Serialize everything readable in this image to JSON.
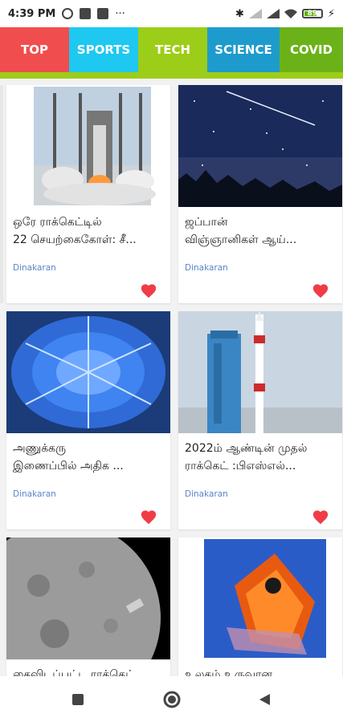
{
  "status_bar": {
    "time": "4:39 PM",
    "more": "···",
    "battery": "89"
  },
  "tabs": [
    {
      "label": "TOP",
      "color": "#f04e4e"
    },
    {
      "label": "SPORTS",
      "color": "#1ec8f0"
    },
    {
      "label": "TECH",
      "color": "#9ccd18"
    },
    {
      "label": "SCIENCE",
      "color": "#1e9bcd"
    },
    {
      "label": "COVID",
      "color": "#6bb219"
    }
  ],
  "articles": [
    {
      "title": "ஒரே ராக்கெட்டில்\n22 செயற்கைகோள்: சீ...",
      "source": "Dinakaran"
    },
    {
      "title": "ஜப்பான்\nவிஞ்ஞானிகள் ஆய்...",
      "source": "Dinakaran"
    },
    {
      "title": "அணுக்கரு\nஇணைப்பில் அதிக ...",
      "source": "Dinakaran"
    },
    {
      "title": "2022ம் ஆண்டின் முதல்\nராக்கெட் :பிஎஸ்எல்...",
      "source": "Dinakaran"
    },
    {
      "title": "கைவிடப்பட்ட ராக்கெட்",
      "source": ""
    },
    {
      "title": "உலகம் உருவான",
      "source": ""
    }
  ],
  "colors": {
    "heart": "#f03c46",
    "source": "#5a83c9",
    "tab_indicator": "#9ccd18"
  },
  "nav": {
    "recents_icon": "square-icon",
    "home_icon": "circle-icon",
    "back_icon": "triangle-back-icon"
  }
}
